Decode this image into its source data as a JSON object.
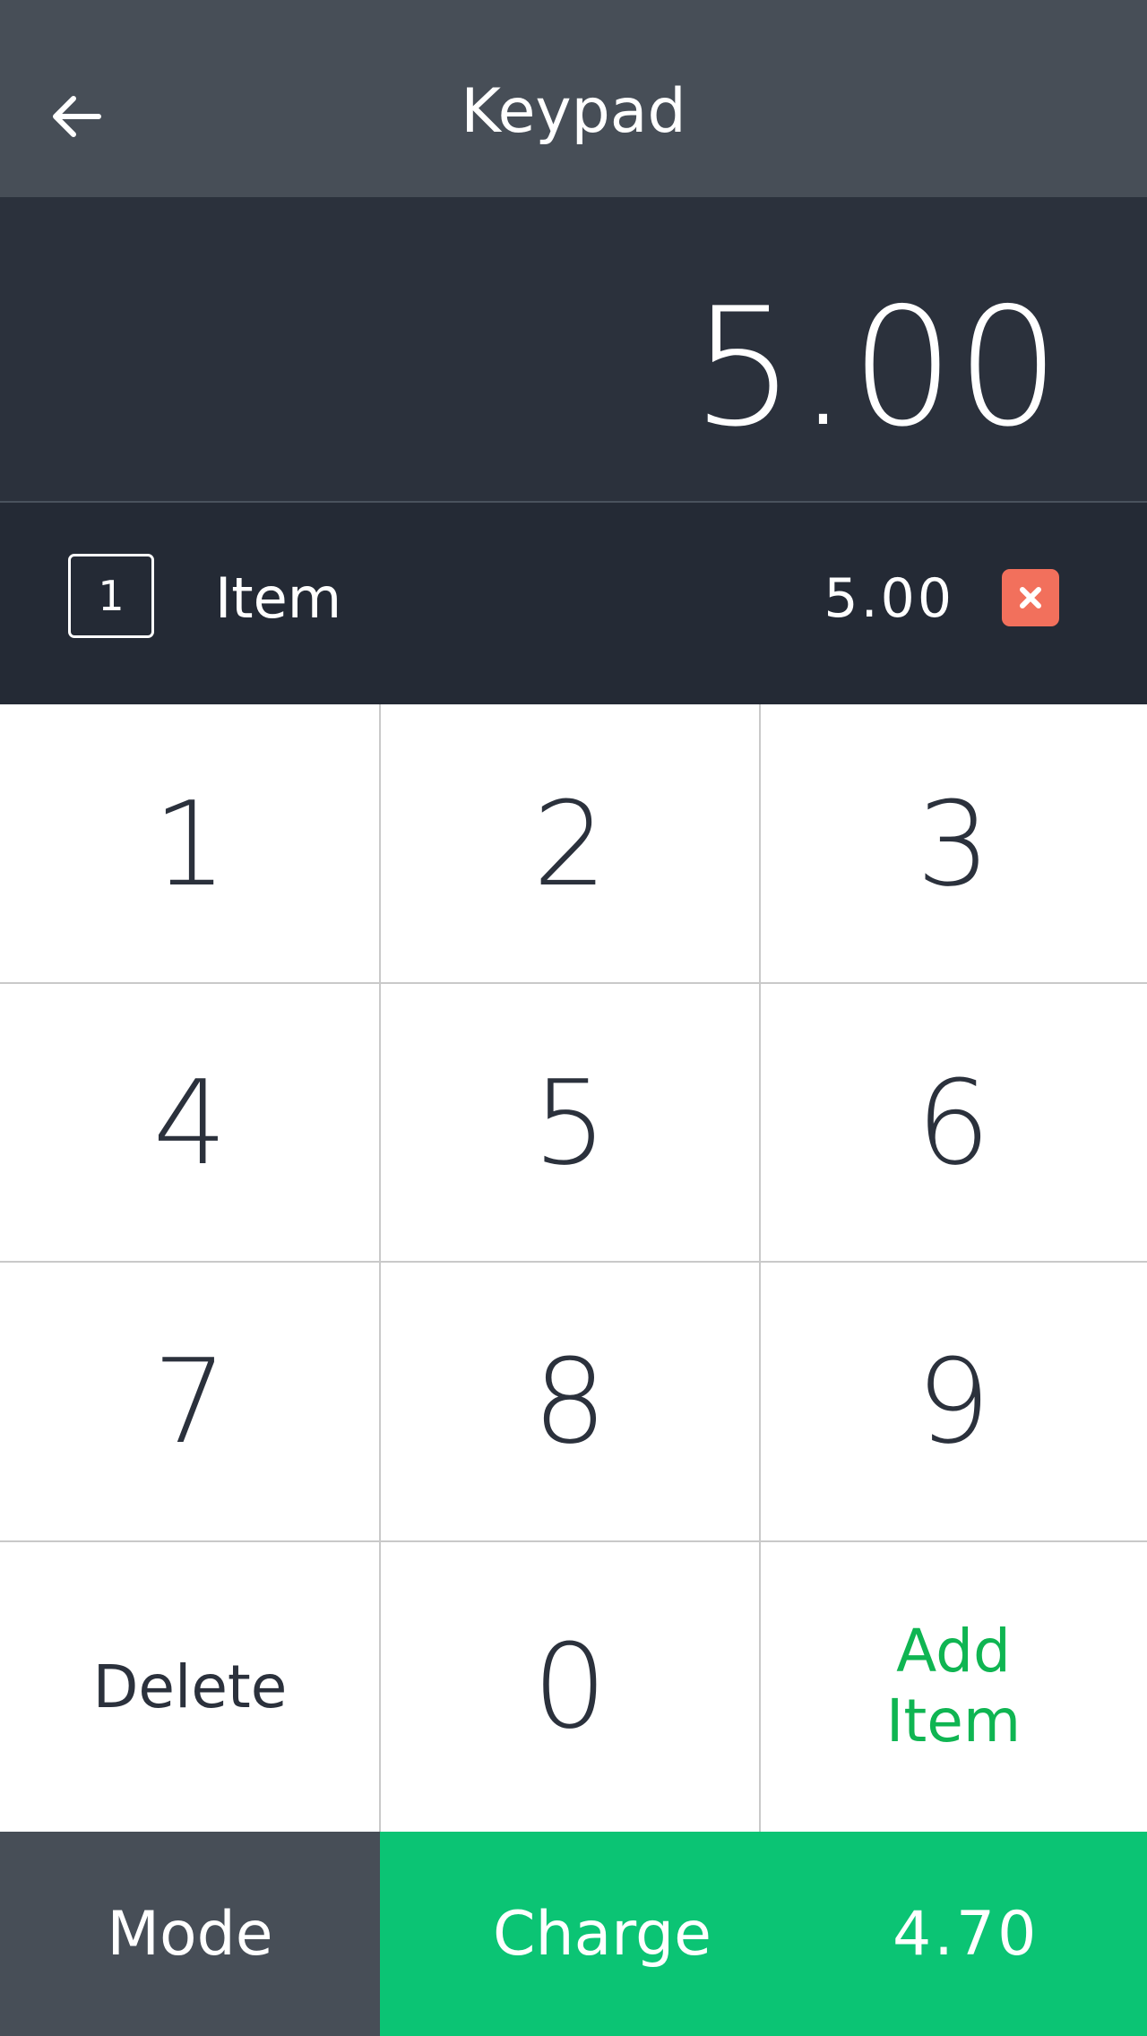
{
  "header": {
    "title": "Keypad",
    "back_icon": "arrow-left-icon"
  },
  "display": {
    "amount": "5.00"
  },
  "line_item": {
    "quantity": "1",
    "name": "Item",
    "price": "5.00",
    "remove_icon": "close-icon",
    "remove_color": "#f2705c"
  },
  "keypad": {
    "keys": [
      "1",
      "2",
      "3",
      "4",
      "5",
      "6",
      "7",
      "8",
      "9"
    ],
    "delete_label": "Delete",
    "zero_label": "0",
    "add_item_line1": "Add",
    "add_item_line2": "Item",
    "add_item_color": "#0fb552"
  },
  "footer": {
    "mode_label": "Mode",
    "charge_label": "Charge",
    "charge_total": "4.70",
    "charge_color": "#0bc474"
  }
}
